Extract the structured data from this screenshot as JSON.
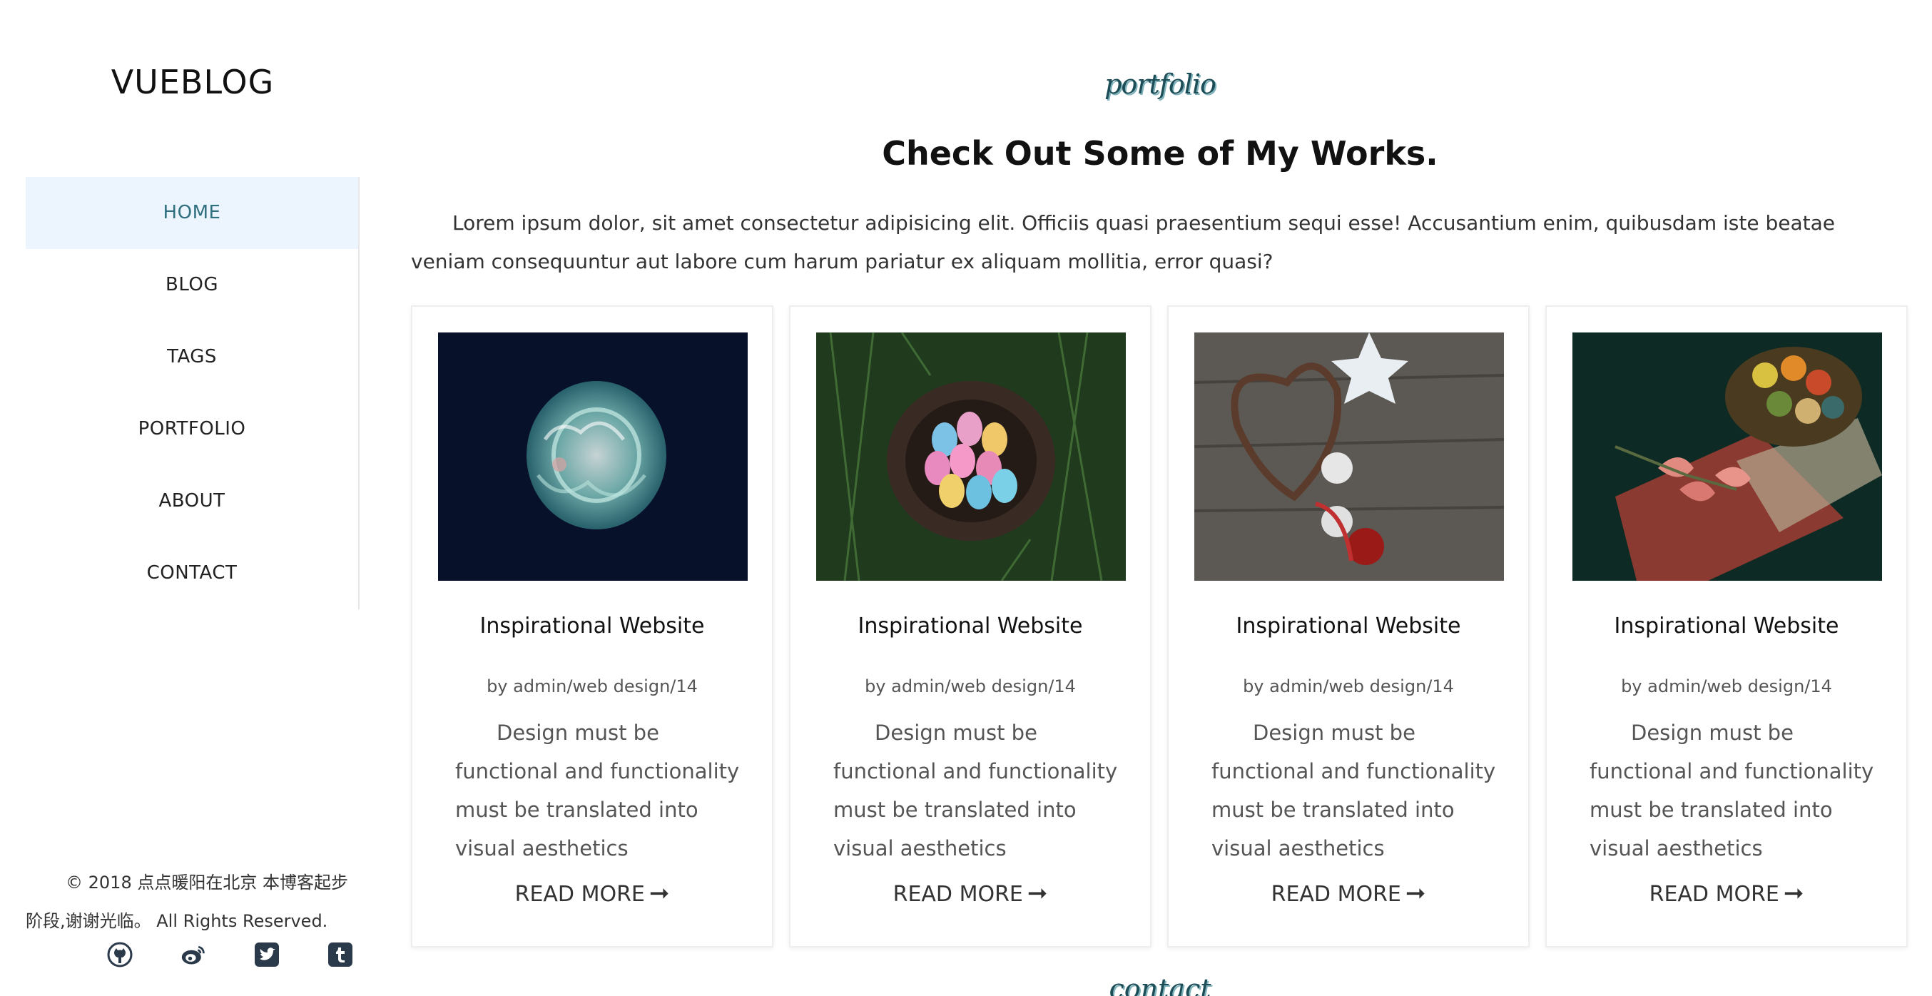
{
  "sidebar": {
    "logo": "VUEBLOG",
    "nav": [
      {
        "label": "HOME",
        "active": true
      },
      {
        "label": "BLOG",
        "active": false
      },
      {
        "label": "TAGS",
        "active": false
      },
      {
        "label": "PORTFOLIO",
        "active": false
      },
      {
        "label": "ABOUT",
        "active": false
      },
      {
        "label": "CONTACT",
        "active": false
      }
    ],
    "copyright": "© 2018 点点暖阳在北京 本博客起步阶段,谢谢光临。 All Rights Reserved.",
    "socials": [
      "github-icon",
      "weibo-icon",
      "twitter-icon",
      "tumblr-icon"
    ]
  },
  "main": {
    "eyebrow": "portfolio",
    "heading": "Check Out Some of My Works.",
    "intro": "Lorem ipsum dolor, sit amet consectetur adipisicing elit. Officiis quasi praesentium sequi esse! Accusantium enim, quibusdam iste beatae veniam consequuntur aut labore cum harum pariatur ex aliquam mollitia, error quasi?",
    "cards": [
      {
        "image": "jellyfish",
        "title": "Inspirational Website",
        "meta": "by admin/web design/14",
        "desc": "Design must be functional and functionality must be translated into visual aesthetics",
        "more": "READ MORE"
      },
      {
        "image": "eggs-nest",
        "title": "Inspirational Website",
        "meta": "by admin/web design/14",
        "desc": "Design must be functional and functionality must be translated into visual aesthetics",
        "more": "READ MORE"
      },
      {
        "image": "christmas-ornaments",
        "title": "Inspirational Website",
        "meta": "by admin/web design/14",
        "desc": "Design must be functional and functionality must be translated into visual aesthetics",
        "more": "READ MORE"
      },
      {
        "image": "thread-spools-roses",
        "title": "Inspirational Website",
        "meta": "by admin/web design/14",
        "desc": "Design must be functional and functionality must be translated into visual aesthetics",
        "more": "READ MORE"
      }
    ],
    "next_section": "contact"
  },
  "colors": {
    "active_bg": "#ecf5fd",
    "active_text": "#2f6f7e",
    "accent": "#1d4e57"
  }
}
